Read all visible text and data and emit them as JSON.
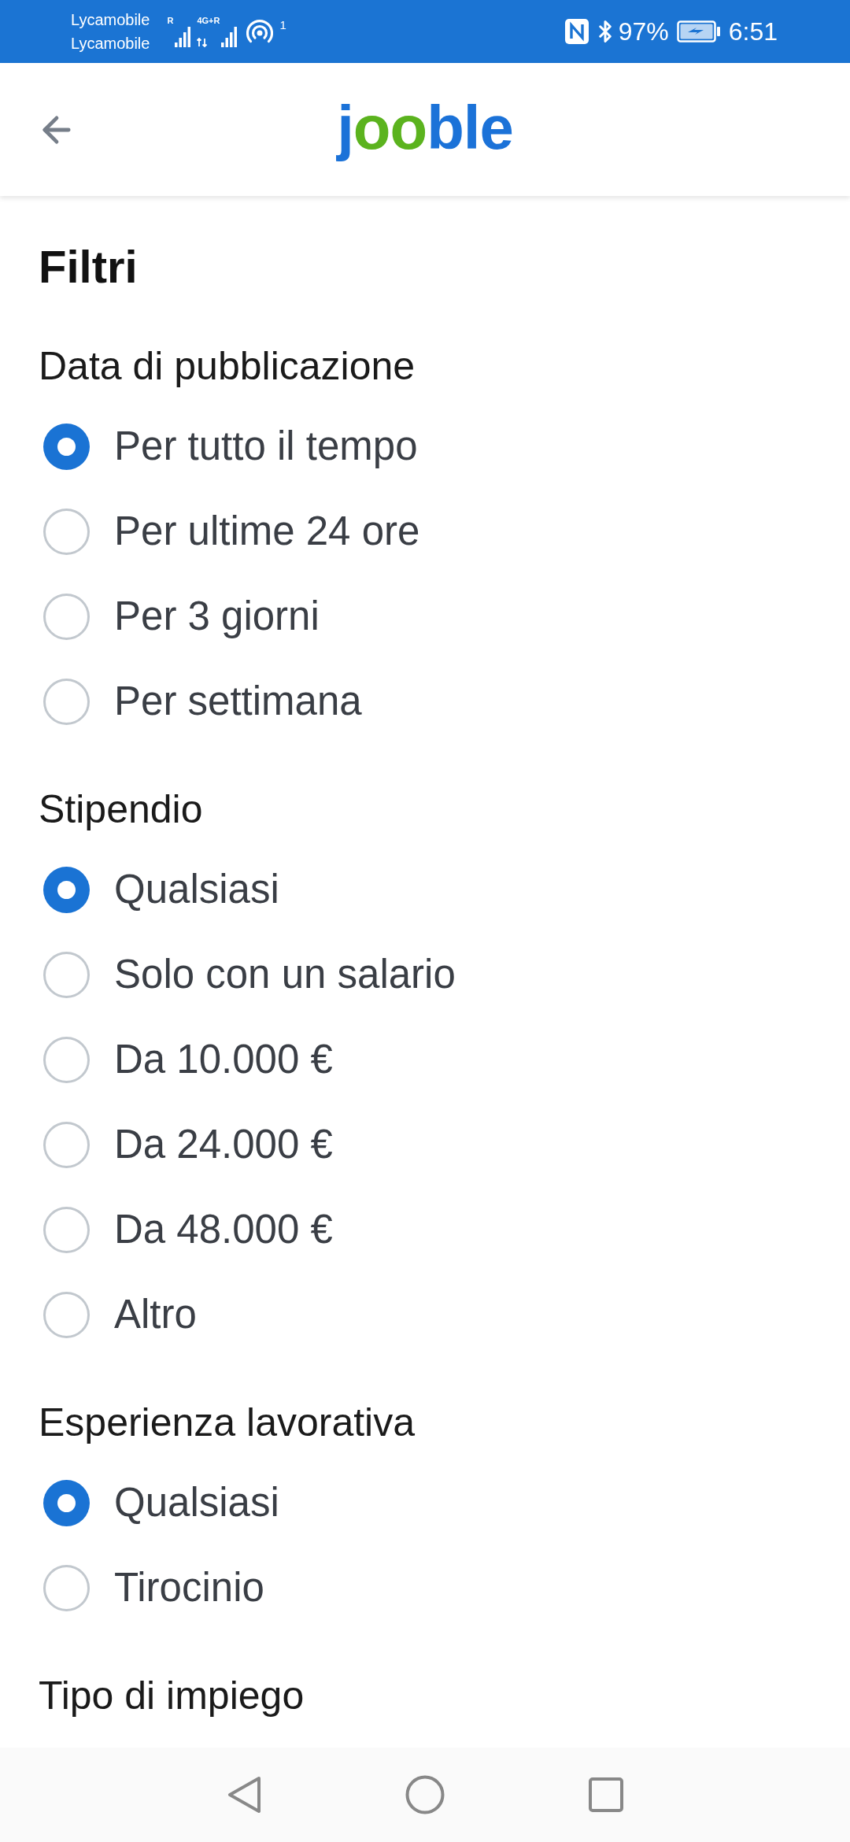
{
  "status_bar": {
    "carriers": [
      "Lycamobile",
      "Lycamobile"
    ],
    "signals": [
      {
        "label": "R"
      },
      {
        "label": "4G+R"
      }
    ],
    "hotspot_count": "1",
    "battery": "97%",
    "time": "6:51"
  },
  "header": {
    "logo": [
      {
        "text": "j",
        "color": "#1b72d8"
      },
      {
        "text": "oo",
        "color": "#5bb31e"
      },
      {
        "text": "ble",
        "color": "#1b72d8"
      }
    ]
  },
  "title": "Filtri",
  "sections": [
    {
      "heading": "Data di pubblicazione",
      "options": [
        {
          "label": "Per tutto il tempo",
          "selected": true
        },
        {
          "label": "Per ultime 24 ore",
          "selected": false
        },
        {
          "label": "Per 3 giorni",
          "selected": false
        },
        {
          "label": "Per settimana",
          "selected": false
        }
      ]
    },
    {
      "heading": "Stipendio",
      "options": [
        {
          "label": "Qualsiasi",
          "selected": true
        },
        {
          "label": "Solo con un salario",
          "selected": false
        },
        {
          "label": "Da 10.000 €",
          "selected": false
        },
        {
          "label": "Da 24.000 €",
          "selected": false
        },
        {
          "label": "Da 48.000 €",
          "selected": false
        },
        {
          "label": "Altro",
          "selected": false
        }
      ]
    },
    {
      "heading": "Esperienza lavorativa",
      "options": [
        {
          "label": "Qualsiasi",
          "selected": true
        },
        {
          "label": "Tirocinio",
          "selected": false
        }
      ]
    },
    {
      "heading": "Tipo di impiego"
    }
  ]
}
